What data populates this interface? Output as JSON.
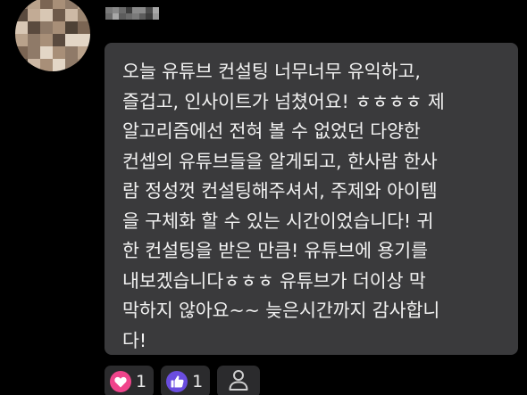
{
  "comment": {
    "text": "오늘 유튜브 컨설팅 너무너무 유익하고,\n즐겁고, 인사이트가 넘쳤어요! ㅎㅎㅎㅎ 제\n알고리즘에선 전혀 볼 수 없었던 다양한\n컨셉의 유튜브들을 알게되고, 한사람 한사\n람 정성껏 컨설팅해주셔서, 주제와 아이템\n을 구체화 할 수 있는 시간이었습니다! 귀\n한 컨설팅을 받은 만큼! 유튜브에 용기를\n내보겠습니다ㅎㅎㅎ 유튜브가 더이상 막\n막하지 않아요~~ 늦은시간까지 감사합니\n다!"
  },
  "reactions": [
    {
      "icon": "heart-icon",
      "count": "1",
      "color": "#f0448b"
    },
    {
      "icon": "thumbs-up-icon",
      "count": "1",
      "color": "#6a4de0"
    }
  ],
  "colors": {
    "background": "#000000",
    "bubble": "#3a3a3c",
    "text": "#f2f2f2",
    "reaction_bg": "#2b2b2d"
  }
}
